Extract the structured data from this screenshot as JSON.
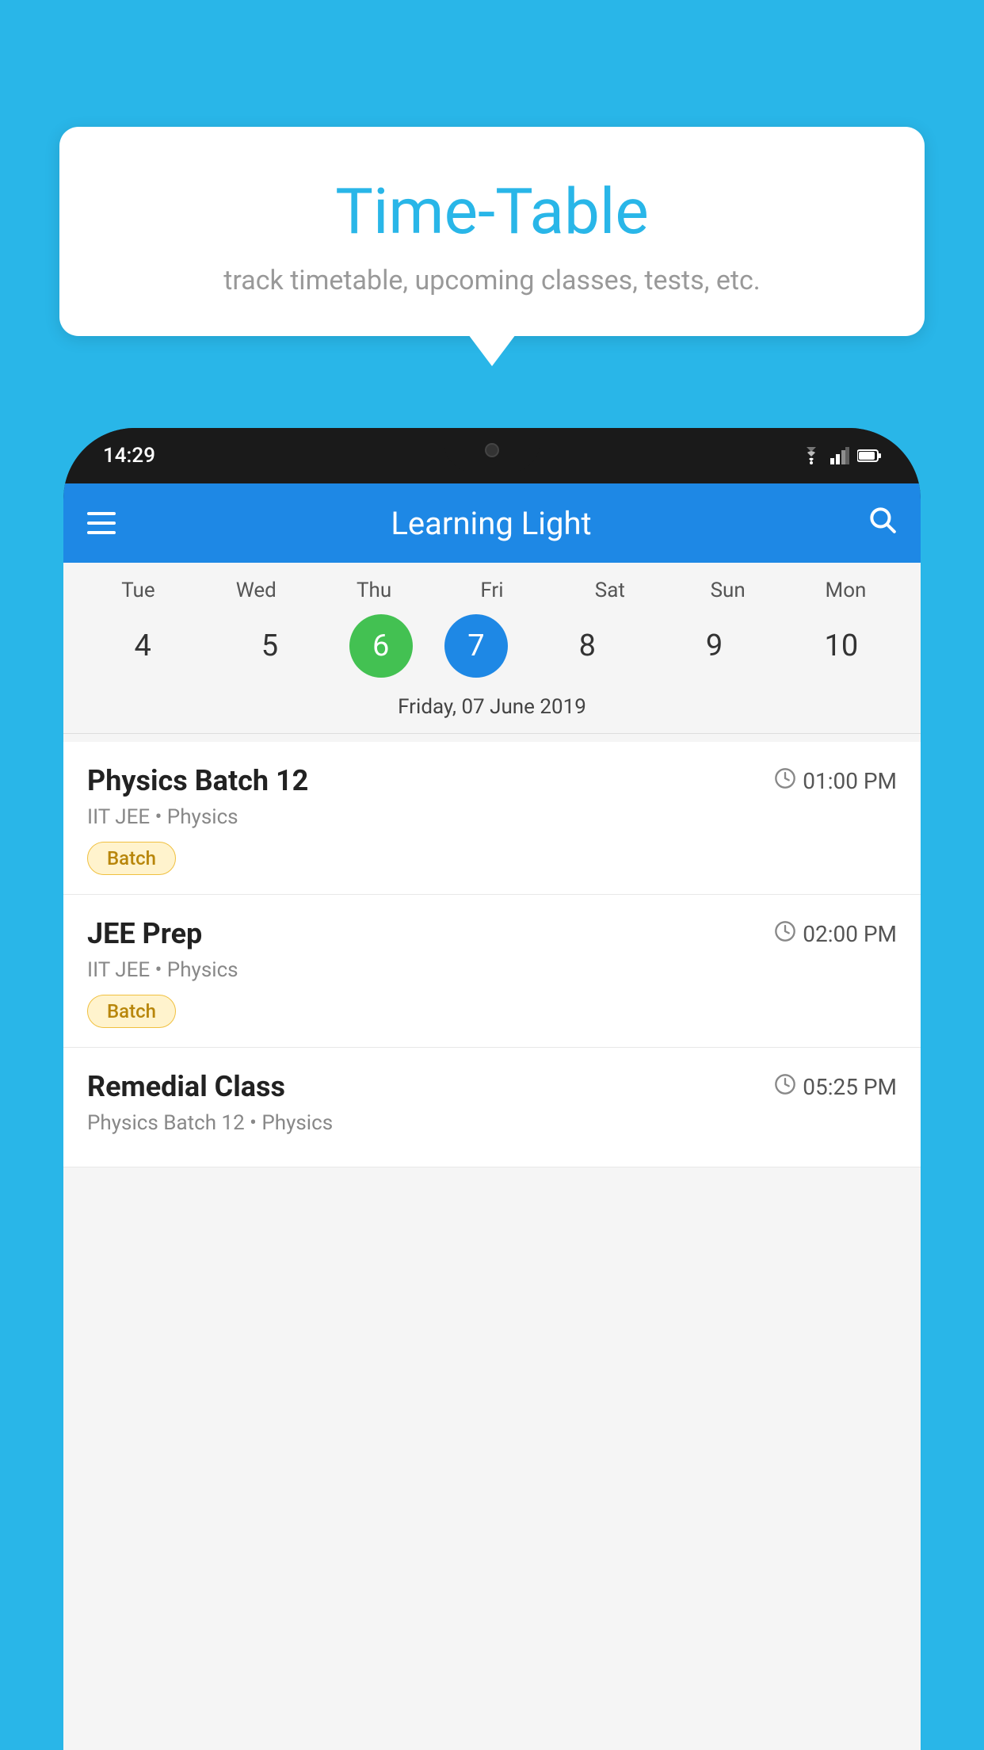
{
  "background_color": "#29b6e8",
  "tooltip": {
    "title": "Time-Table",
    "subtitle": "track timetable, upcoming classes, tests, etc."
  },
  "phone": {
    "status_bar": {
      "time": "14:29"
    },
    "app_bar": {
      "title": "Learning Light"
    },
    "calendar": {
      "days": [
        {
          "label": "Tue",
          "num": "4"
        },
        {
          "label": "Wed",
          "num": "5"
        },
        {
          "label": "Thu",
          "num": "6",
          "state": "today"
        },
        {
          "label": "Fri",
          "num": "7",
          "state": "selected"
        },
        {
          "label": "Sat",
          "num": "8"
        },
        {
          "label": "Sun",
          "num": "9"
        },
        {
          "label": "Mon",
          "num": "10"
        }
      ],
      "selected_date_label": "Friday, 07 June 2019"
    },
    "classes": [
      {
        "name": "Physics Batch 12",
        "time": "01:00 PM",
        "meta": "IIT JEE • Physics",
        "badge": "Batch"
      },
      {
        "name": "JEE Prep",
        "time": "02:00 PM",
        "meta": "IIT JEE • Physics",
        "badge": "Batch"
      },
      {
        "name": "Remedial Class",
        "time": "05:25 PM",
        "meta": "Physics Batch 12 • Physics",
        "badge": null
      }
    ]
  }
}
